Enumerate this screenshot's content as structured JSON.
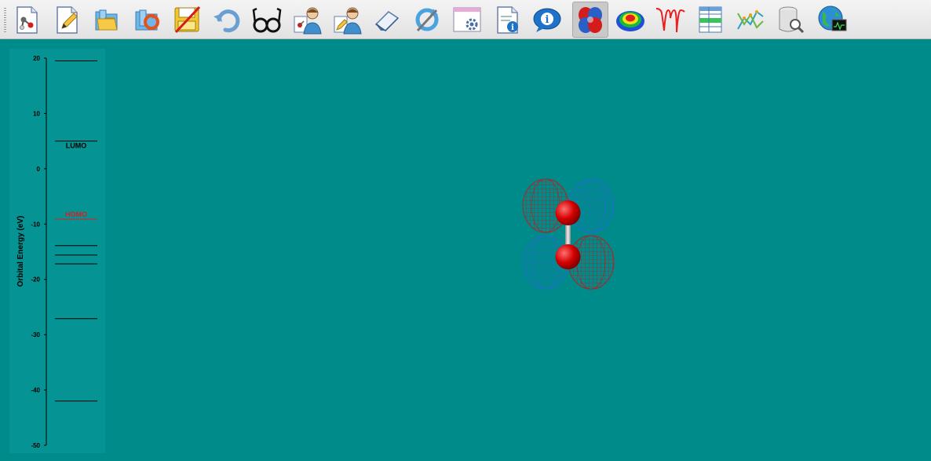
{
  "toolbar": {
    "items": [
      {
        "id": "molecule-builder",
        "active": false
      },
      {
        "id": "edit-input",
        "active": false
      },
      {
        "id": "open-file",
        "active": false
      },
      {
        "id": "reopen-file",
        "active": false
      },
      {
        "id": "save-file",
        "active": false
      },
      {
        "id": "undo",
        "active": false
      },
      {
        "id": "view-glasses",
        "active": false
      },
      {
        "id": "user-molecule",
        "active": false
      },
      {
        "id": "user-edit",
        "active": false
      },
      {
        "id": "eraser",
        "active": false
      },
      {
        "id": "refresh",
        "active": false
      },
      {
        "id": "window-settings",
        "active": false
      },
      {
        "id": "document-info",
        "active": false
      },
      {
        "id": "info",
        "active": false
      },
      {
        "id": "orbitals",
        "active": true
      },
      {
        "id": "density-surface",
        "active": false
      },
      {
        "id": "spectrum",
        "active": false
      },
      {
        "id": "table",
        "active": false
      },
      {
        "id": "plot",
        "active": false
      },
      {
        "id": "database-search",
        "active": false
      },
      {
        "id": "web-monitor",
        "active": false
      }
    ]
  },
  "energy_diagram": {
    "axis_label": "Orbital Energy (eV)",
    "ylim": [
      -50,
      20
    ],
    "ticks": [
      20,
      10,
      0,
      -10,
      -20,
      -30,
      -40,
      -50
    ],
    "levels": [
      19.5,
      5.0,
      -9.1,
      -13.9,
      -15.6,
      -17.2,
      -27.1,
      -42.0
    ],
    "lumo": {
      "label": "LUMO",
      "energy": 5.0,
      "color": "#000000"
    },
    "homo": {
      "label": "HOMO",
      "energy": -9.1,
      "color": "#d42020"
    }
  },
  "colors": {
    "background": "#008b8b",
    "panel": "#069393",
    "orbital_positive": "#b22222",
    "orbital_negative": "#1e70c8",
    "atom": "#d40000"
  }
}
